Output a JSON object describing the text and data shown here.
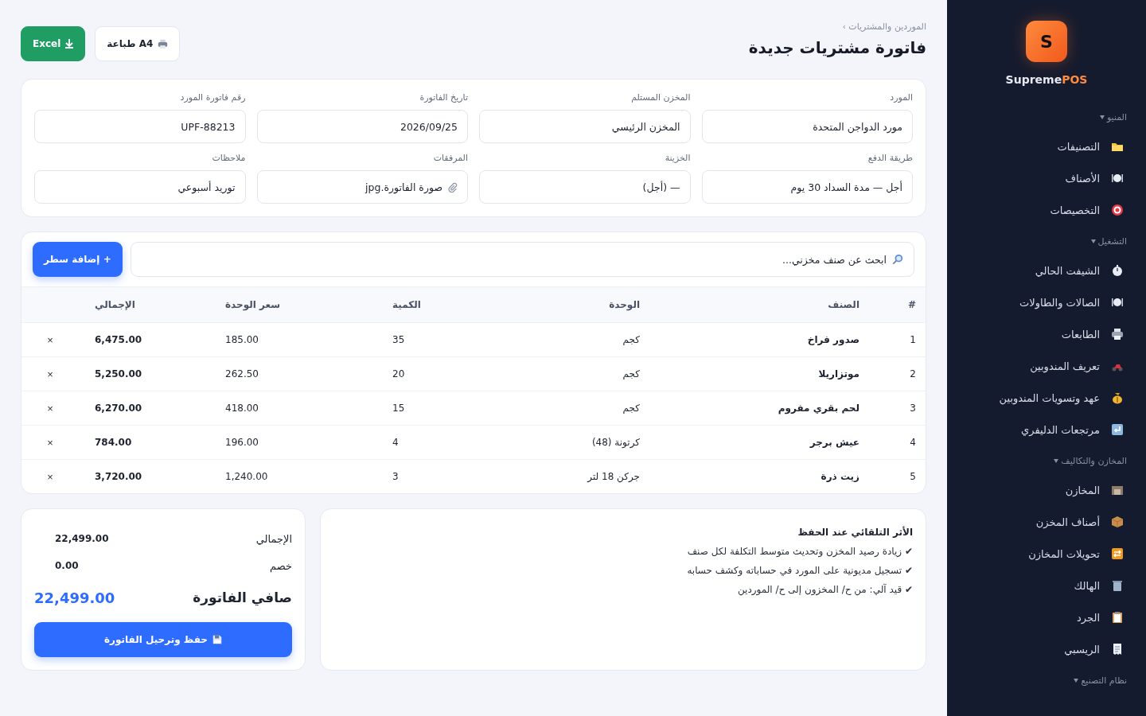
{
  "sidebar": {
    "logo_letter": "S",
    "brand": {
      "name": "Supreme",
      "suffix": "POS"
    },
    "sections": [
      {
        "title": "المنيو",
        "expanded": true,
        "items": [
          "التصنيفات",
          "الأصناف",
          "التخصيصات"
        ]
      },
      {
        "title": "التشغيل",
        "expanded": true,
        "items": [
          "الشيفت الحالي",
          "الصالات والطاولات",
          "الطابعات",
          "تعريف المندوبين",
          "عهد وتسويات المندوبين",
          "مرتجعات الدليفري"
        ]
      },
      {
        "title": "المخازن والتكاليف",
        "expanded": true,
        "items": [
          "المخازن",
          "أصناف المخزن",
          "تحويلات المخازن",
          "الهالك",
          "الجرد",
          "الريسبي"
        ]
      },
      {
        "title": "نظام التصنيع",
        "expanded": true
      }
    ]
  },
  "header": {
    "breadcrumb": "الموردين والمشتريات ›",
    "title": "فاتورة مشتريات جديدة",
    "actions": [
      {
        "kind": "print",
        "label": "طباعة A4"
      },
      {
        "kind": "excel",
        "label": "Excel"
      }
    ]
  },
  "form": {
    "fields": [
      {
        "label": "المورد",
        "value": "مورد الدواجن المتحدة"
      },
      {
        "label": "المخزن المستلم",
        "value": "المخزن الرئيسي"
      },
      {
        "label": "تاريخ الفاتورة",
        "value": "2026/09/25"
      },
      {
        "label": "رقم فاتورة المورد",
        "value": "UPF-88213"
      },
      {
        "label": "طريقة الدفع",
        "value": "أجل — مدة السداد 30 يوم"
      },
      {
        "label": "الخزينة",
        "value": "— (أجل)"
      },
      {
        "label": "المرفقات",
        "value": "صورة الفاتورة.jpg",
        "kind": "attachment"
      },
      {
        "label": "ملاحظات",
        "value": "توريد أسبوعي"
      }
    ]
  },
  "items": {
    "search": {
      "placeholder": "ابحث عن صنف مخزني..."
    },
    "add_button": "+ إضافة سطر",
    "columns": [
      "#",
      "الصنف",
      "الوحدة",
      "الكمية",
      "سعر الوحدة",
      "الإجمالي"
    ],
    "rows": [
      {
        "no": "1",
        "item": "صدور فراخ",
        "unit": "كجم",
        "qty": "35",
        "price": "185.00",
        "total": "6,475.00",
        "remove": "×"
      },
      {
        "no": "2",
        "item": "موتزاريلا",
        "unit": "كجم",
        "qty": "20",
        "price": "262.50",
        "total": "5,250.00",
        "remove": "×"
      },
      {
        "no": "3",
        "item": "لحم بقري مفروم",
        "unit": "كجم",
        "qty": "15",
        "price": "418.00",
        "total": "6,270.00",
        "remove": "×"
      },
      {
        "no": "4",
        "item": "عيش برجر",
        "unit": "كرتونة (48)",
        "qty": "4",
        "price": "196.00",
        "total": "784.00",
        "remove": "×"
      },
      {
        "no": "5",
        "item": "زيت ذرة",
        "unit": "جركن 18 لتر",
        "qty": "3",
        "price": "1,240.00",
        "total": "3,720.00",
        "remove": "×"
      }
    ]
  },
  "effects": {
    "title": "الأثر التلقائي عند الحفظ",
    "lines": [
      "✔ زيادة رصيد المخزن وتحديث متوسط التكلفة لكل صنف",
      "✔ تسجيل مديونية على المورد في حساباته وكشف حسابه",
      "✔ قيد آلي: من ح/ المخزون إلى ح/ الموردين"
    ]
  },
  "summary": {
    "rows": [
      {
        "label": "الإجمالي",
        "value": "22,499.00"
      },
      {
        "label": "خصم",
        "value": "0.00"
      }
    ],
    "net": {
      "label": "صافي الفاتورة",
      "value": "22,499.00"
    },
    "save_button": "حفظ وترحيل الفاتورة"
  }
}
